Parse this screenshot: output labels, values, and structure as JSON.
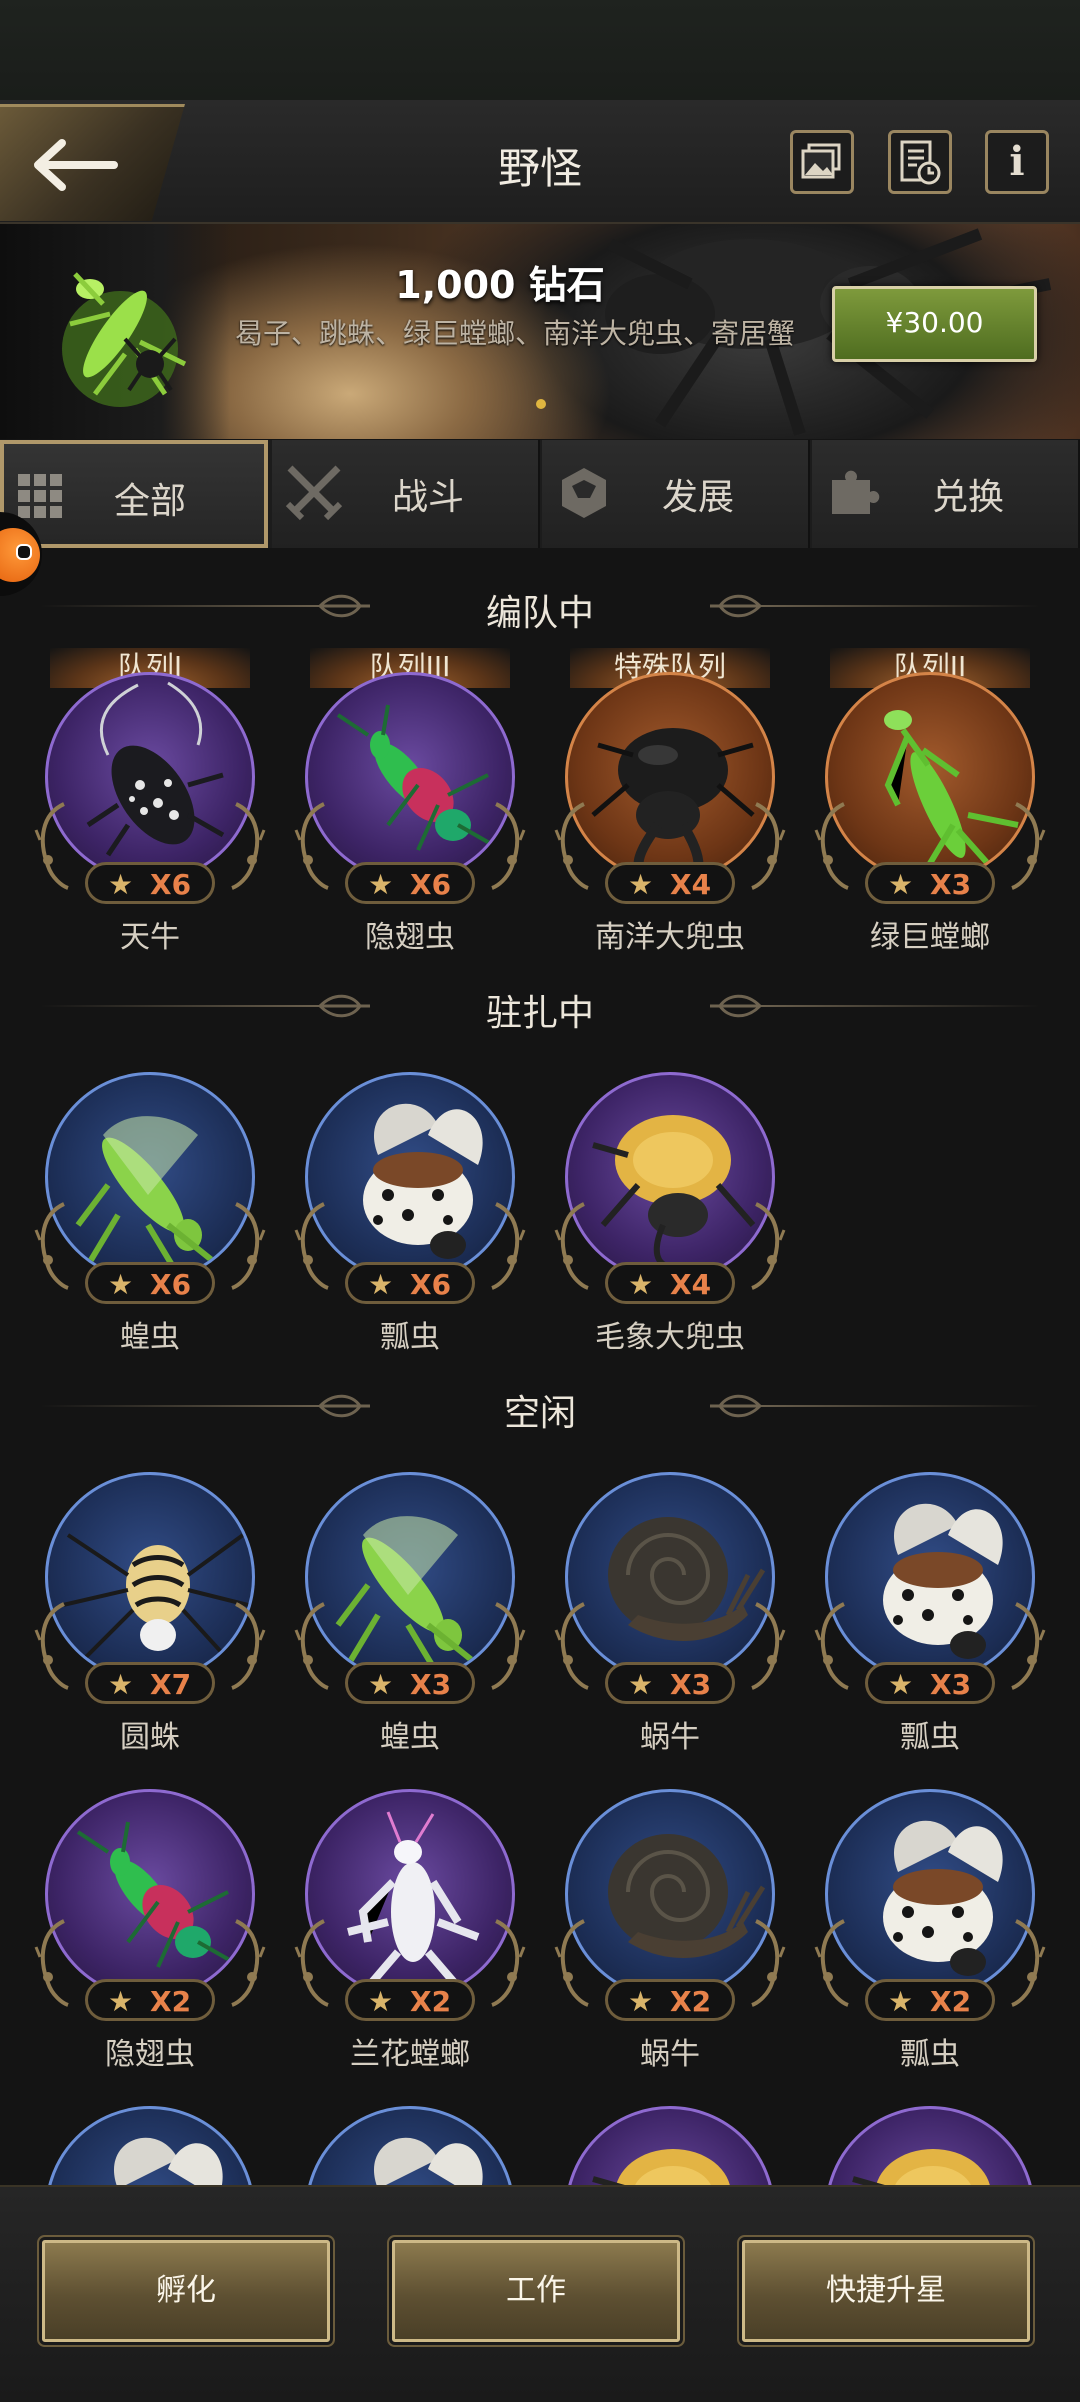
{
  "header": {
    "title": "野怪"
  },
  "banner": {
    "title": "1,000 钻石",
    "description": "曷子、跳蛛、绿巨螳螂、南洋大兜虫、寄居蟹",
    "price": "¥30.00"
  },
  "tabs": [
    {
      "label": "全部",
      "icon": "grid-icon",
      "active": true
    },
    {
      "label": "战斗",
      "icon": "crossed-swords-icon",
      "active": false
    },
    {
      "label": "发展",
      "icon": "development-icon",
      "active": false
    },
    {
      "label": "兑换",
      "icon": "puzzle-icon",
      "active": false
    }
  ],
  "sections": {
    "formation": {
      "title": "编队中",
      "units": [
        {
          "queue": "队列I",
          "name": "天牛",
          "stars": "X6",
          "rarity": "purple",
          "creature": "longhorn-beetle"
        },
        {
          "queue": "队列III",
          "name": "隐翅虫",
          "stars": "X6",
          "rarity": "purple",
          "creature": "rove-beetle"
        },
        {
          "queue": "特殊队列",
          "name": "南洋大兜虫",
          "stars": "X4",
          "rarity": "orange",
          "creature": "atlas-beetle"
        },
        {
          "queue": "队列II",
          "name": "绿巨螳螂",
          "stars": "X3",
          "rarity": "orange",
          "creature": "mantis"
        }
      ]
    },
    "stationed": {
      "title": "驻扎中",
      "units": [
        {
          "name": "蝗虫",
          "stars": "X6",
          "rarity": "blue",
          "creature": "locust"
        },
        {
          "name": "瓢虫",
          "stars": "X6",
          "rarity": "blue",
          "creature": "ladybug"
        },
        {
          "name": "毛象大兜虫",
          "stars": "X4",
          "rarity": "purple",
          "creature": "elephant-beetle"
        }
      ]
    },
    "idle": {
      "title": "空闲",
      "units": [
        {
          "name": "圆蛛",
          "stars": "X7",
          "rarity": "blue",
          "creature": "spider"
        },
        {
          "name": "蝗虫",
          "stars": "X3",
          "rarity": "blue",
          "creature": "locust"
        },
        {
          "name": "蜗牛",
          "stars": "X3",
          "rarity": "blue",
          "creature": "snail"
        },
        {
          "name": "瓢虫",
          "stars": "X3",
          "rarity": "blue",
          "creature": "ladybug"
        },
        {
          "name": "隐翅虫",
          "stars": "X2",
          "rarity": "purple",
          "creature": "rove-beetle"
        },
        {
          "name": "兰花螳螂",
          "stars": "X2",
          "rarity": "purple",
          "creature": "orchid-mantis"
        },
        {
          "name": "蜗牛",
          "stars": "X2",
          "rarity": "blue",
          "creature": "snail"
        },
        {
          "name": "瓢虫",
          "stars": "X2",
          "rarity": "blue",
          "creature": "ladybug"
        }
      ],
      "partial": [
        {
          "rarity": "blue",
          "creature": "ladybug"
        },
        {
          "rarity": "blue",
          "creature": "ladybug"
        },
        {
          "rarity": "purple",
          "creature": "elephant-beetle"
        },
        {
          "rarity": "purple",
          "creature": "elephant-beetle"
        }
      ]
    }
  },
  "actions": {
    "hatch": "孵化",
    "work": "工作",
    "quick_star": "快捷升星"
  },
  "star_glyph": "★"
}
